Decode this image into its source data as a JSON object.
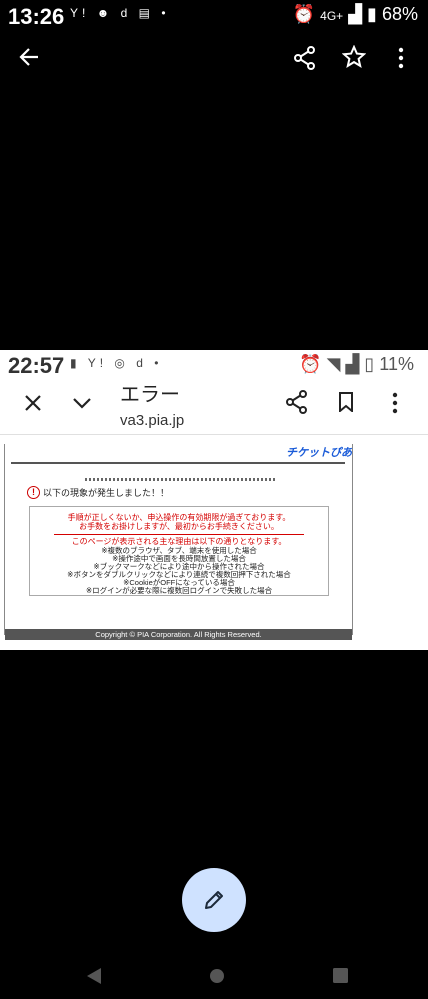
{
  "outer_status": {
    "time": "13:26",
    "notification_icons": "Y! ☻ d ▤ •",
    "network": "4G+",
    "battery": "68%"
  },
  "viewer_toolbar": {
    "icons": [
      "back-arrow-icon",
      "share-icon",
      "star-icon",
      "more-vert-icon"
    ]
  },
  "screenshot": {
    "status": {
      "time": "22:57",
      "notification_icons": "▮ Y! ◎ d •",
      "battery": "11%"
    },
    "browser": {
      "title": "エラー",
      "url": "va3.pia.jp",
      "icons": [
        "close-icon",
        "chevron-down-icon",
        "share-icon",
        "bookmark-icon",
        "more-vert-icon"
      ]
    },
    "page": {
      "logo": "チケットぴあ",
      "separator": "************************************************",
      "alert": "以下の現象が発生しました！！",
      "red_lines": [
        "手順が正しくないか、申込操作の有効期限が過ぎております。",
        "お手数をお掛けしますが、最初からお手続きください。",
        "このページが表示される主な理由は以下の通りとなります。"
      ],
      "reasons": [
        "※複数のブラウザ、タブ、端末を使用した場合",
        "※操作途中で画面を長時間放置した場合",
        "※ブックマークなどにより途中から操作された場合",
        "※ボタンをダブルクリックなどにより連続で複数回押下された場合",
        "※CookieがOFFになっている場合",
        "※ログインが必要な際に複数回ログインで失敗した場合"
      ],
      "copyright": "Copyright © PIA Corporation. All Rights Reserved."
    }
  },
  "fab": {
    "icon": "pencil-icon"
  },
  "nav": {
    "icons": [
      "back-triangle-icon",
      "home-circle-icon",
      "recents-square-icon"
    ]
  }
}
